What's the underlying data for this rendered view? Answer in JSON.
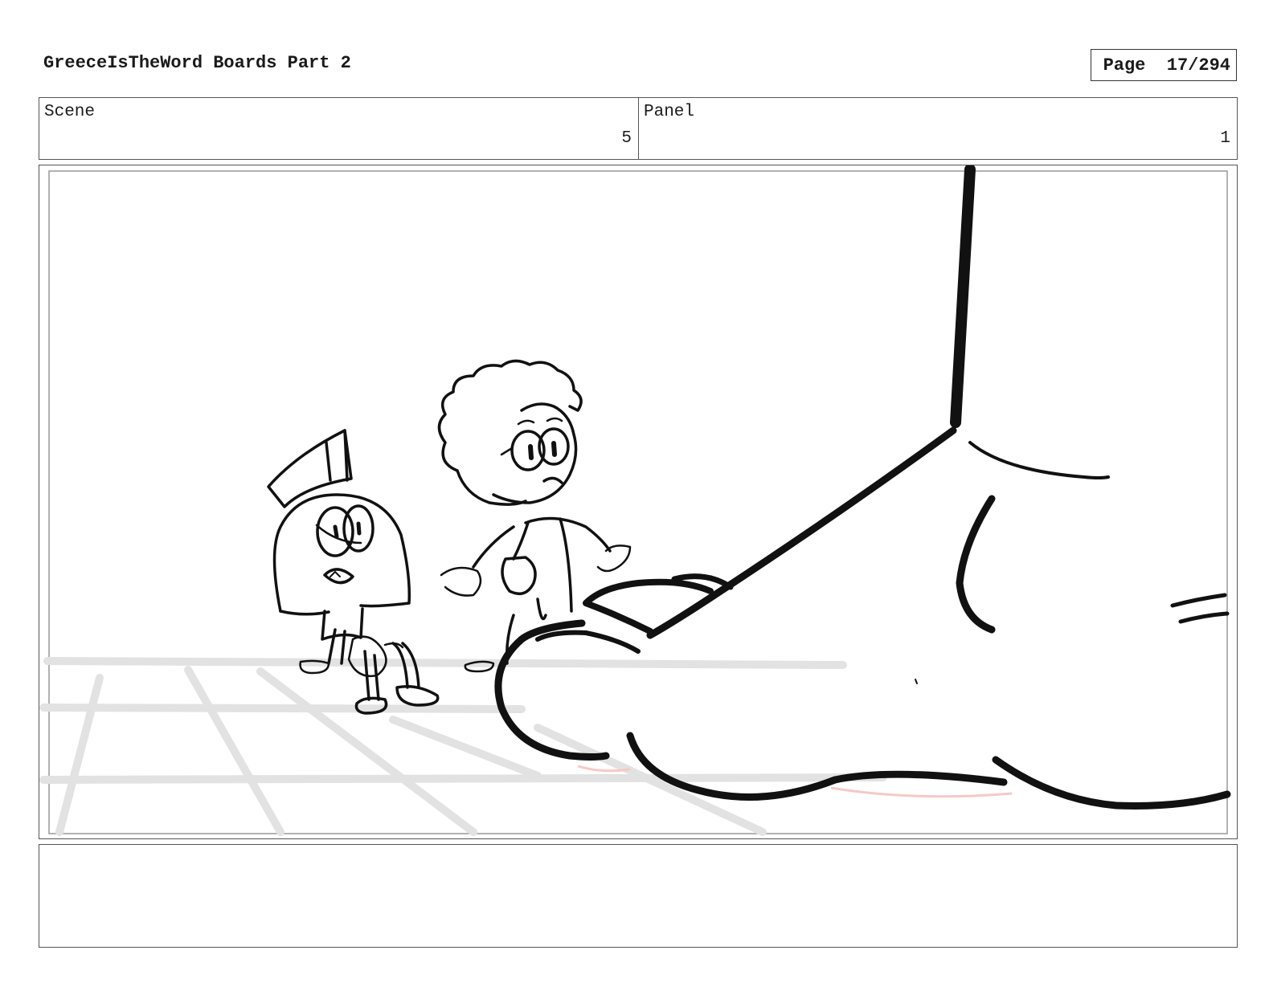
{
  "header": {
    "title": "GreeceIsTheWord Boards Part 2",
    "page_label": "Page",
    "page_number": "17/294"
  },
  "info": {
    "scene_label": "Scene",
    "scene_value": "5",
    "panel_label": "Panel",
    "panel_value": "1"
  },
  "frame": {
    "description_icon": "storyboard-drawing",
    "floor_color": "#e2e2e2",
    "ink_color": "#111111",
    "shadow_tint": "#f6c9c4"
  },
  "notes": {
    "text": ""
  }
}
